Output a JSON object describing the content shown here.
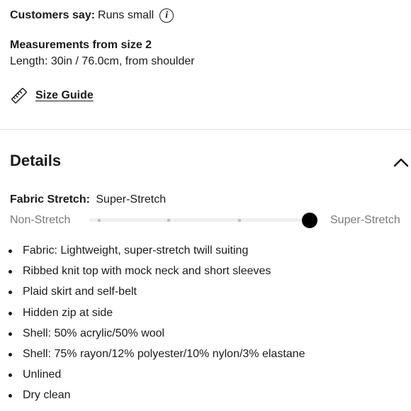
{
  "fit": {
    "label": "Customers say:",
    "value": "Runs small",
    "info_glyph": "i"
  },
  "measurements": {
    "title": "Measurements from size 2",
    "length": "Length: 30in / 76.0cm, from shoulder"
  },
  "size_guide": {
    "label": "Size Guide",
    "icon": "ruler-icon"
  },
  "details": {
    "title": "Details",
    "expanded": true,
    "toggle_icon": "chevron-up-icon"
  },
  "stretch": {
    "label": "Fabric Stretch:",
    "value": "Super-Stretch",
    "min_label": "Non-Stretch",
    "max_label": "Super-Stretch",
    "level": 1.0
  },
  "bullets": [
    "Fabric: Lightweight, super-stretch twill suiting",
    "Ribbed knit top with mock neck and short sleeves",
    "Plaid skirt and self-belt",
    "Hidden zip at side",
    "Shell: 50% acrylic/50% wool",
    "Shell: 75% rayon/12% polyester/10% nylon/3% elastane",
    "Unlined",
    "Dry clean"
  ],
  "colors": {
    "text": "#1b1b1b",
    "muted": "#7a7a7a",
    "divider": "#dcdcdc",
    "slider_knob": "#000000"
  }
}
